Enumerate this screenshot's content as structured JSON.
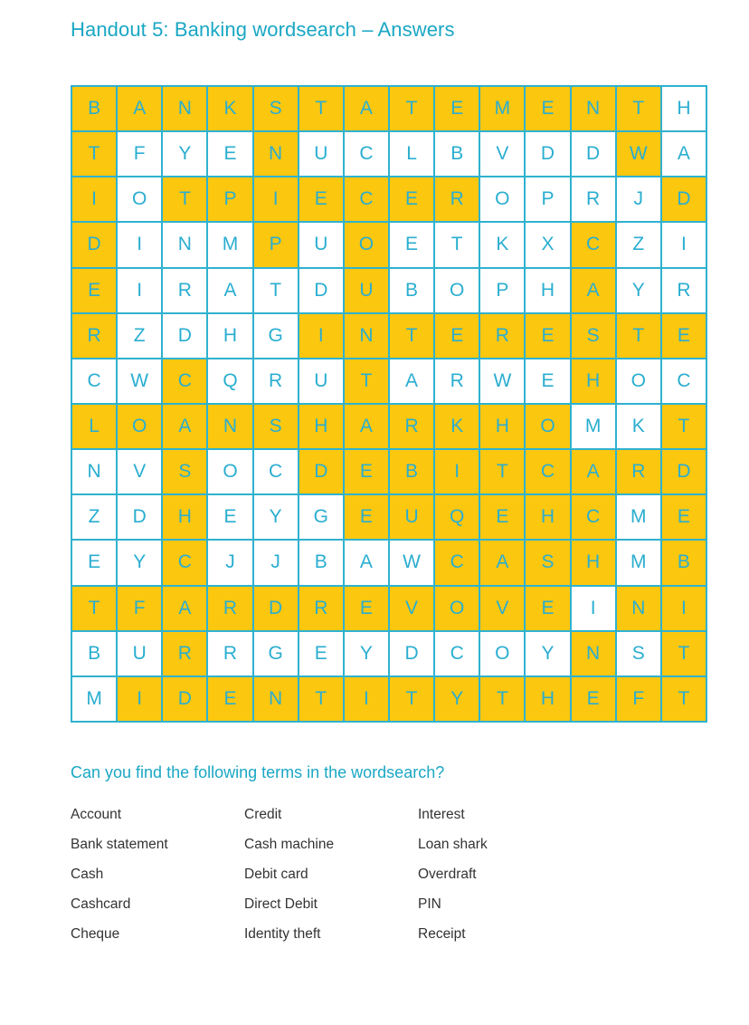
{
  "title": "Handout 5: Banking wordsearch – Answers",
  "colors": {
    "accent": "#1aa7c4",
    "grid_line": "#2fb2cf",
    "highlight": "#fcc70f",
    "letter": "#2aaed0"
  },
  "grid": {
    "rows": [
      "BANKSTATEMENTH",
      "TFYENUCLBVDDWA",
      "IOTPIECEROPRJD",
      "DINMPUOETKXCZI",
      "EIRATDUBOPHAYR",
      "RZDHGINTERESTE",
      "CWCQRUTARWEHOC",
      "LOANSHARKHOMKT",
      "NVSOCDEBITCARD",
      "ZDHEYGEUQEHCME",
      "EYCJJBAWCASHMB",
      "TFARDREVOVEINI",
      "BURRGEYDCOYNST",
      "MIDENTITYTHEFT"
    ],
    "highlight": [
      "11111111111110",
      "10001000000010",
      "10111111100001",
      "10001010000100",
      "10000010000100",
      "10000111111111",
      "00100010000100",
      "11111111111001",
      "00100111111111",
      "00100011111101",
      "00100000111101",
      "11111111111011",
      "00100000000101",
      "01111111111111"
    ]
  },
  "prompt": "Can you find the following terms in the wordsearch?",
  "terms": [
    "Account",
    "Credit",
    "Interest",
    "Bank statement",
    "Cash machine",
    "Loan shark",
    "Cash",
    "Debit card",
    "Overdraft",
    "Cashcard",
    "Direct Debit",
    "PIN",
    "Cheque",
    "Identity theft",
    "Receipt"
  ]
}
